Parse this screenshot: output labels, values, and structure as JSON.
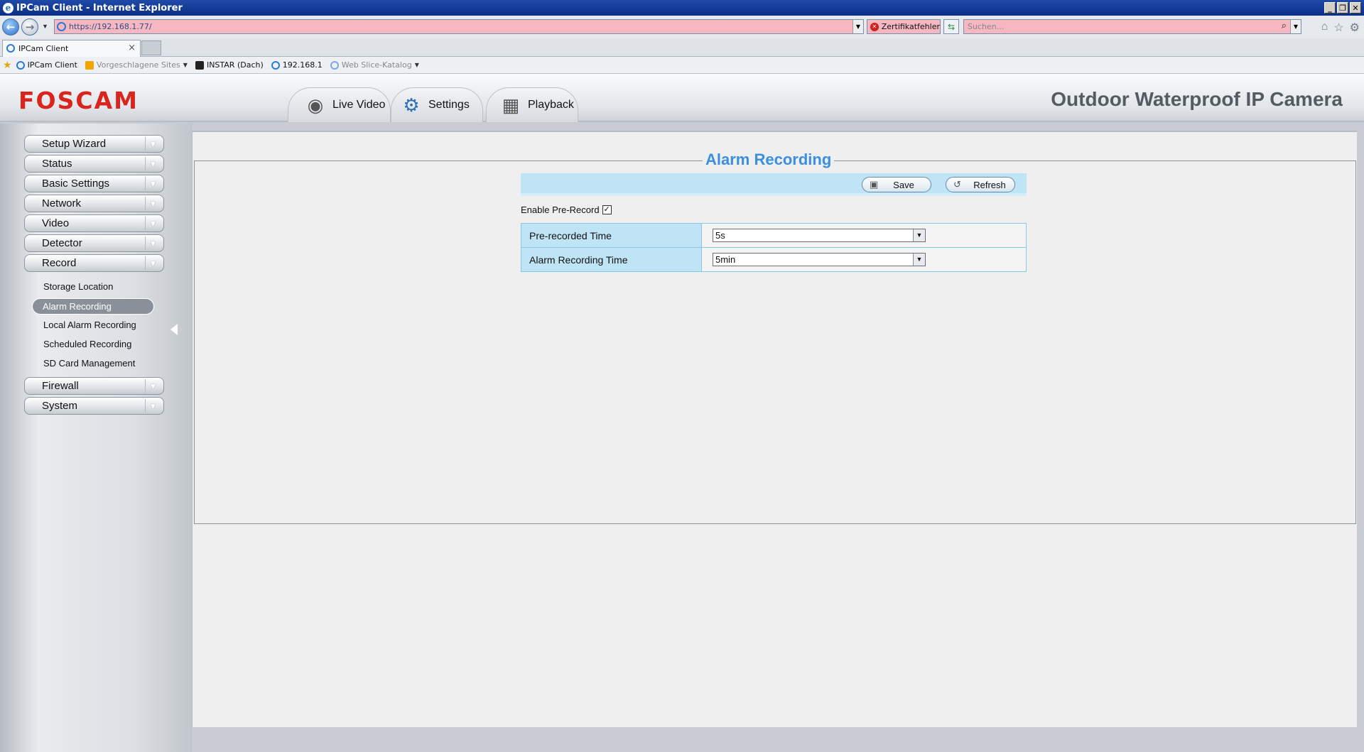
{
  "window": {
    "title": "IPCam Client - Internet Explorer",
    "buttons": [
      "_",
      "❐",
      "✕"
    ]
  },
  "addressbar": {
    "url": "https://192.168.1.77/",
    "cert_error": "Zertifikatfehler",
    "search_placeholder": "Suchen..."
  },
  "browser_tab": {
    "label": "IPCam Client"
  },
  "favorites": [
    {
      "label": "IPCam Client",
      "icon": "ie-icon",
      "grey": false,
      "dropdown": false
    },
    {
      "label": "Vorgeschlagene Sites",
      "icon": "bing-icon",
      "grey": true,
      "dropdown": true
    },
    {
      "label": "INSTAR (Dach)",
      "icon": "instar-icon",
      "grey": false,
      "dropdown": false
    },
    {
      "label": "192.168.1",
      "icon": "ie-icon",
      "grey": false,
      "dropdown": false
    },
    {
      "label": "Web Slice-Katalog",
      "icon": "ie-icon",
      "grey": true,
      "dropdown": true
    }
  ],
  "header": {
    "logo": "FOSCAM",
    "camera_title": "Outdoor Waterproof IP Camera",
    "tabs": [
      {
        "label": "Live Video",
        "icon": "webcam-icon"
      },
      {
        "label": "Settings",
        "icon": "gears-icon"
      },
      {
        "label": "Playback",
        "icon": "calendar-icon"
      }
    ]
  },
  "sidebar": {
    "menus_top": [
      "Setup Wizard",
      "Status",
      "Basic Settings",
      "Network",
      "Video",
      "Detector",
      "Record"
    ],
    "record_submenu": [
      "Storage Location",
      "Alarm Recording",
      "Local Alarm Recording",
      "Scheduled Recording",
      "SD Card Management"
    ],
    "active_submenu": "Alarm Recording",
    "menus_bottom": [
      "Firewall",
      "System"
    ]
  },
  "panel": {
    "title": "Alarm Recording",
    "save_label": "Save",
    "refresh_label": "Refresh",
    "enable_prerecord_label": "Enable Pre-Record",
    "enable_prerecord_checked": true,
    "rows": [
      {
        "label": "Pre-recorded Time",
        "value": "5s"
      },
      {
        "label": "Alarm Recording Time",
        "value": "5min"
      }
    ]
  },
  "colors": {
    "accent": "#3b8fdd",
    "logo": "#d9251d",
    "row_label_bg": "#bfe4f5",
    "address_error": "#f7b7c1"
  }
}
